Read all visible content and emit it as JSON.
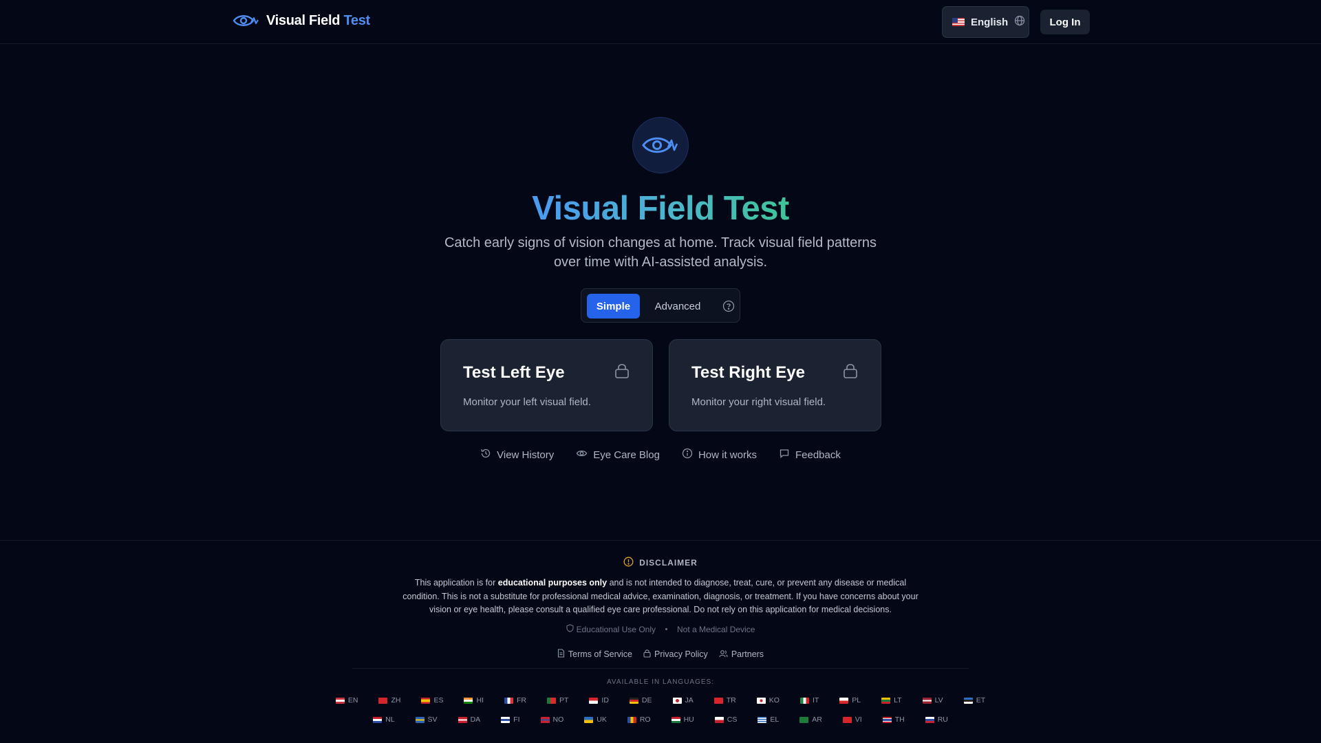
{
  "header": {
    "brand_main": "Visual Field",
    "brand_accent": "Test",
    "language_label": "English",
    "login_label": "Log In"
  },
  "hero": {
    "title": "Visual Field Test",
    "subtitle": "Catch early signs of vision changes at home. Track visual field patterns over time with AI-assisted analysis."
  },
  "mode": {
    "simple_label": "Simple",
    "advanced_label": "Advanced",
    "selected": "Simple"
  },
  "cards": [
    {
      "title": "Test Left Eye",
      "description": "Monitor your left visual field."
    },
    {
      "title": "Test Right Eye",
      "description": "Monitor your right visual field."
    }
  ],
  "links": [
    {
      "label": "View History",
      "icon": "history-icon"
    },
    {
      "label": "Eye Care Blog",
      "icon": "eye-icon"
    },
    {
      "label": "How it works",
      "icon": "info-icon"
    },
    {
      "label": "Feedback",
      "icon": "message-icon"
    }
  ],
  "disclaimer": {
    "heading": "DISCLAIMER",
    "body_pre": "This application is for ",
    "body_bold": "educational purposes only",
    "body_post": " and is not intended to diagnose, treat, cure, or prevent any disease or medical condition. This is not a substitute for professional medical advice, examination, diagnosis, or treatment. If you have concerns about your vision or eye health, please consult a qualified eye care professional. Do not rely on this application for medical decisions.",
    "badge_1": "Educational Use Only",
    "badge_2": "Not a Medical Device"
  },
  "legal": {
    "terms": "Terms of Service",
    "privacy": "Privacy Policy",
    "partners": "Partners"
  },
  "languages": {
    "heading": "AVAILABLE IN LANGUAGES:",
    "row1": [
      "EN",
      "ZH",
      "ES",
      "HI",
      "FR",
      "PT",
      "ID",
      "DE",
      "JA",
      "TR",
      "KO",
      "IT",
      "PL",
      "LT",
      "LV",
      "ET"
    ],
    "row2": [
      "NL",
      "SV",
      "DA",
      "FI",
      "NO",
      "UK",
      "RO",
      "HU",
      "CS",
      "EL",
      "AR",
      "VI",
      "TH",
      "RU"
    ]
  },
  "colors": {
    "background": "#040816",
    "accent_blue": "#2563eb",
    "card_bg": "#1b2232",
    "title_gradient_start": "#4a9af2",
    "title_gradient_end": "#3ec597",
    "warning": "#e0a030"
  }
}
